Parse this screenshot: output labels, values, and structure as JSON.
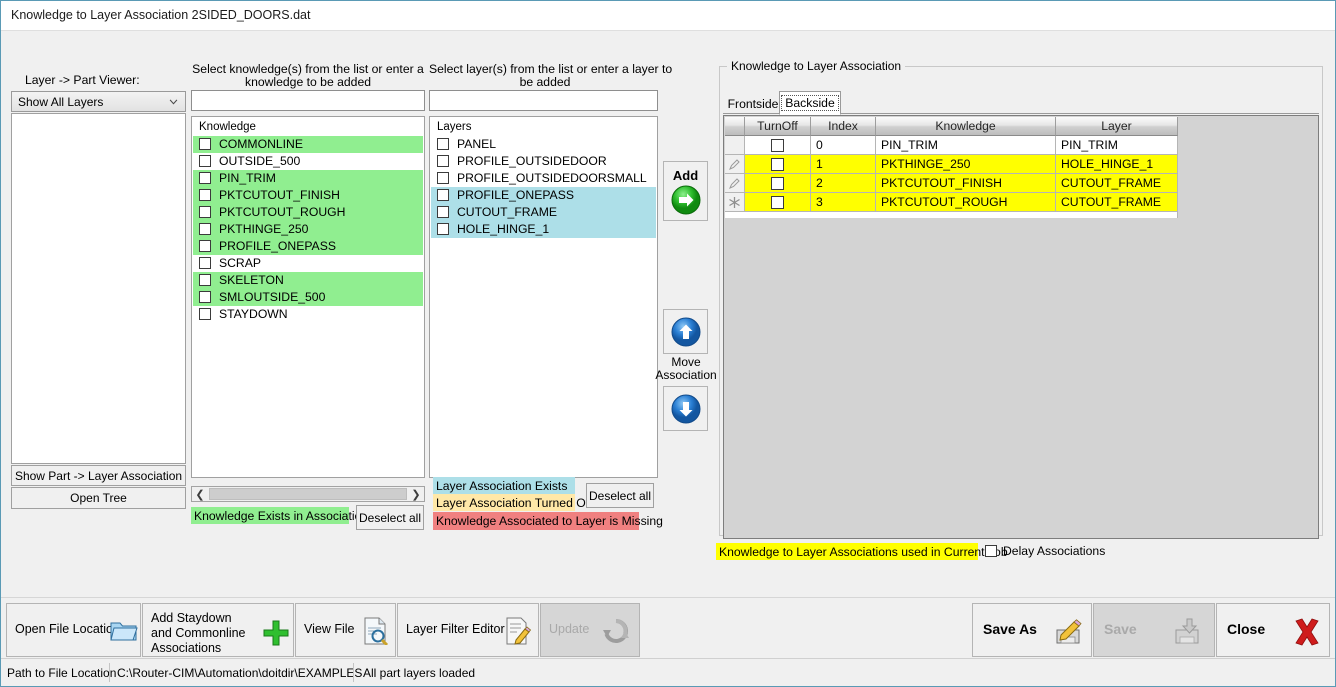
{
  "window": {
    "title": "Knowledge to Layer Association 2SIDED_DOORS.dat"
  },
  "left_panel": {
    "viewer_label": "Layer -> Part Viewer:",
    "combo_value": "Show All Layers",
    "show_part_layer_button": "Show Part -> Layer Association",
    "open_tree_button": "Open Tree"
  },
  "knowledge_panel": {
    "instruction": "Select knowledge(s) from the list or enter a\nknowledge to be added",
    "entry_value": "",
    "list_header": "Knowledge",
    "items": [
      {
        "label": "COMMONLINE",
        "checked": false,
        "state": "exists"
      },
      {
        "label": "OUTSIDE_500",
        "checked": false,
        "state": "none"
      },
      {
        "label": "PIN_TRIM",
        "checked": false,
        "state": "exists"
      },
      {
        "label": "PKTCUTOUT_FINISH",
        "checked": false,
        "state": "exists"
      },
      {
        "label": "PKTCUTOUT_ROUGH",
        "checked": false,
        "state": "exists"
      },
      {
        "label": "PKTHINGE_250",
        "checked": false,
        "state": "exists"
      },
      {
        "label": "PROFILE_ONEPASS",
        "checked": false,
        "state": "exists"
      },
      {
        "label": "SCRAP",
        "checked": false,
        "state": "none"
      },
      {
        "label": "SKELETON",
        "checked": false,
        "state": "exists"
      },
      {
        "label": "SMLOUTSIDE_500",
        "checked": false,
        "state": "exists"
      },
      {
        "label": "STAYDOWN",
        "checked": false,
        "state": "none"
      }
    ],
    "legend": "Knowledge Exists in Associations",
    "deselect_button": "Deselect all"
  },
  "layers_panel": {
    "instruction": "Select layer(s) from the list or enter a layer to\nbe added",
    "entry_value": "",
    "list_header": "Layers",
    "items": [
      {
        "label": "PANEL",
        "checked": false,
        "state": "none"
      },
      {
        "label": "PROFILE_OUTSIDEDOOR",
        "checked": false,
        "state": "none"
      },
      {
        "label": "PROFILE_OUTSIDEDOORSMALL",
        "checked": false,
        "state": "none"
      },
      {
        "label": "PROFILE_ONEPASS",
        "checked": false,
        "state": "exists"
      },
      {
        "label": "CUTOUT_FRAME",
        "checked": false,
        "state": "exists"
      },
      {
        "label": "HOLE_HINGE_1",
        "checked": false,
        "state": "exists"
      }
    ],
    "legend_exists": "Layer Association Exists",
    "legend_turned_off": "Layer Association Turned Off",
    "legend_missing": "Knowledge Associated to Layer is Missing",
    "deselect_button": "Deselect all"
  },
  "middle_buttons": {
    "add_label": "Add",
    "move_label": "Move\nAssociation"
  },
  "association_group": {
    "title": "Knowledge to Layer Association",
    "tabs": [
      {
        "label": "Frontside",
        "selected": false
      },
      {
        "label": "Backside",
        "selected": true
      }
    ],
    "columns": [
      "",
      "TurnOff",
      "Index",
      "Knowledge",
      "Layer"
    ],
    "rows": [
      {
        "marker": "",
        "turn_off": false,
        "index": "0",
        "knowledge": "PIN_TRIM",
        "layer": "PIN_TRIM",
        "highlight": "none"
      },
      {
        "marker": "edit",
        "turn_off": false,
        "index": "1",
        "knowledge": "PKTHINGE_250",
        "layer": "HOLE_HINGE_1",
        "highlight": "yellow"
      },
      {
        "marker": "edit",
        "turn_off": false,
        "index": "2",
        "knowledge": "PKTCUTOUT_FINISH",
        "layer": "CUTOUT_FRAME",
        "highlight": "yellow"
      },
      {
        "marker": "new",
        "turn_off": false,
        "index": "3",
        "knowledge": "PKTCUTOUT_ROUGH",
        "layer": "CUTOUT_FRAME",
        "highlight": "yellow"
      }
    ],
    "legend_current_job": "Knowledge to Layer Associations used in Current Job",
    "delay_checkbox_label": "Delay Associations",
    "delay_checked": false
  },
  "toolbar": {
    "open_file_location": "Open File Location",
    "add_staydown": "Add Staydown\nand Commonline\nAssociations",
    "view_file": "View File",
    "layer_filter_editor": "Layer Filter Editor",
    "update": "Update",
    "update_enabled": false,
    "save_as": "Save As",
    "save": "Save",
    "save_enabled": false,
    "close": "Close"
  },
  "statusbar": {
    "path_label": "Path to File Location",
    "path_value": "C:\\Router-CIM\\Automation\\doitdir\\EXAMPLES",
    "message": "All part layers loaded"
  },
  "colors": {
    "green_exists": "#90ee90",
    "blue_exists": "#addfe8",
    "yellow_off": "#ffe8a8",
    "red_missing": "#f08080",
    "yellow_job": "#ffff00",
    "grid_yellow": "#ffff00",
    "accent_red": "#ee1c1c"
  }
}
